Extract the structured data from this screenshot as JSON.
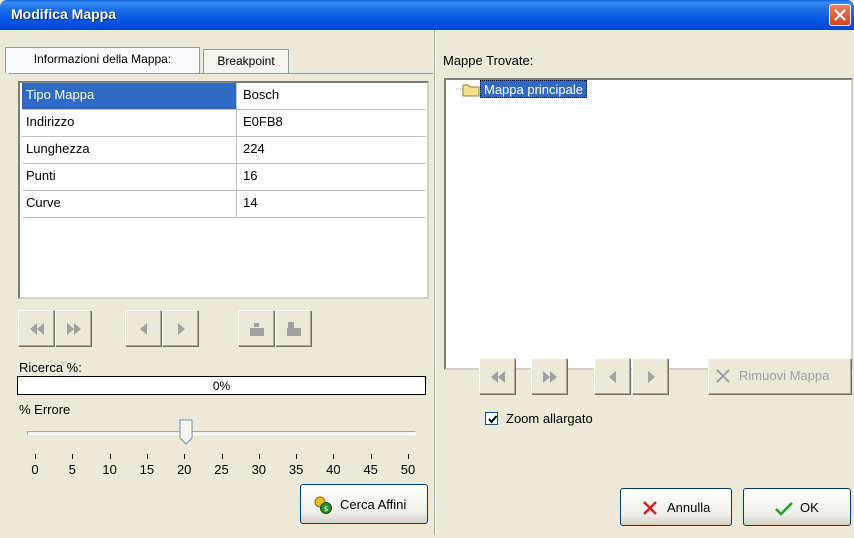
{
  "window": {
    "title": "Modifica Mappa"
  },
  "tabs": [
    {
      "label": "Informazioni della Mappa:"
    },
    {
      "label": "Breakpoint"
    }
  ],
  "map_info": {
    "rows": [
      {
        "name": "Tipo Mappa",
        "value": "Bosch"
      },
      {
        "name": "Indirizzo",
        "value": "E0FB8"
      },
      {
        "name": "Lunghezza",
        "value": "224"
      },
      {
        "name": "Punti",
        "value": "16"
      },
      {
        "name": "Curve",
        "value": "14"
      }
    ]
  },
  "search": {
    "label": "Ricerca %:",
    "progress_text": "0%",
    "progress": 0
  },
  "error": {
    "label": "% Errore",
    "value": 20,
    "ticks": [
      "0",
      "5",
      "10",
      "15",
      "20",
      "25",
      "30",
      "35",
      "40",
      "45",
      "50"
    ]
  },
  "buttons": {
    "find_similar": "Cerca Affini",
    "remove_map": "Rimuovi Mappa",
    "cancel": "Annulla",
    "ok": "OK"
  },
  "found_maps": {
    "label": "Mappe Trovate:",
    "items": [
      "Mappa principale"
    ]
  },
  "zoom": {
    "label": "Zoom allargato",
    "checked": true
  },
  "colors": {
    "titlebar": "#0054E3",
    "selection": "#316AC5",
    "face": "#ECE9D8",
    "disabled_icon": "#A0A0A0"
  },
  "icons": {
    "nav": [
      "first-icon",
      "last-icon",
      "prev-icon",
      "next-icon",
      "move-down-icon",
      "move-up-icon"
    ],
    "buttons": [
      "coins-icon",
      "x-icon",
      "check-icon",
      "close-icon",
      "folder-icon"
    ]
  }
}
